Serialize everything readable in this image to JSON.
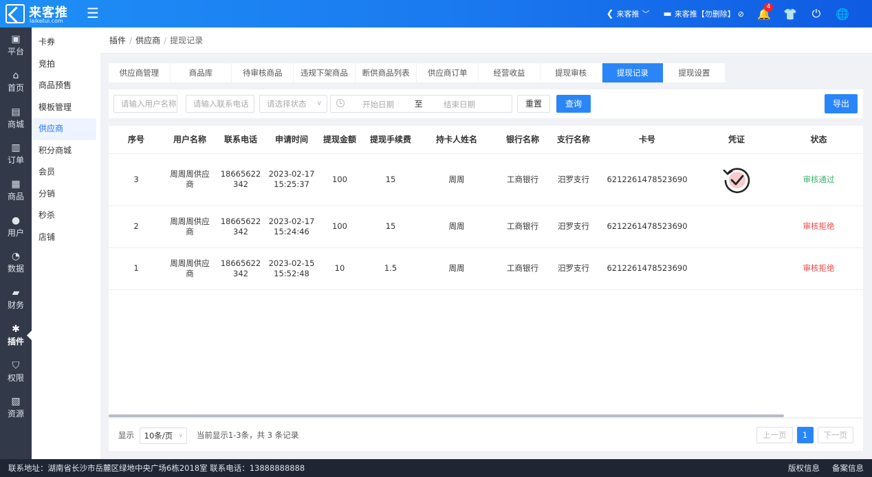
{
  "header": {
    "logo_title": "来客推",
    "logo_sub": "laiketui.com",
    "store_name": "来客推",
    "account_name": "来客推【勿删除】",
    "notification_count": "4"
  },
  "rail": [
    {
      "label": "平台",
      "icon": "monitor-icon"
    },
    {
      "label": "首页",
      "icon": "home-icon"
    },
    {
      "label": "商城",
      "icon": "store-icon"
    },
    {
      "label": "订单",
      "icon": "order-icon"
    },
    {
      "label": "商品",
      "icon": "goods-icon"
    },
    {
      "label": "用户",
      "icon": "user-icon"
    },
    {
      "label": "数据",
      "icon": "pie-chart-icon"
    },
    {
      "label": "财务",
      "icon": "wallet-icon"
    },
    {
      "label": "插件",
      "icon": "puzzle-icon"
    },
    {
      "label": "权限",
      "icon": "shield-icon"
    },
    {
      "label": "资源",
      "icon": "image-icon"
    }
  ],
  "subnav": [
    "卡券",
    "竞拍",
    "商品预售",
    "模板管理",
    "供应商",
    "积分商城",
    "会员",
    "分销",
    "秒杀",
    "店铺"
  ],
  "breadcrumb": {
    "a": "插件",
    "b": "供应商",
    "c": "提现记录"
  },
  "tabs": [
    "供应商管理",
    "商品库",
    "待审核商品",
    "违规下架商品",
    "断供商品列表",
    "供应商订单",
    "经营收益",
    "提现审核",
    "提现记录",
    "提现设置"
  ],
  "filters": {
    "user_placeholder": "请输入用户名称",
    "phone_placeholder": "请输入联系电话",
    "status_placeholder": "请选择状态",
    "start_placeholder": "开始日期",
    "to": "至",
    "end_placeholder": "结束日期",
    "reset": "重置",
    "query": "查询",
    "export": "导出"
  },
  "table": {
    "columns": [
      "序号",
      "用户名称",
      "联系电话",
      "申请时间",
      "提现金额",
      "提现手续费",
      "持卡人姓名",
      "银行名称",
      "支行名称",
      "卡号",
      "凭证",
      "状态"
    ],
    "rows": [
      {
        "no": "3",
        "user": "周周周供应商",
        "phone": "18665622342",
        "date": "2023-02-17",
        "time": "15:25:37",
        "amount": "100",
        "fee": "15",
        "holder": "周周",
        "bank": "工商银行",
        "branch": "汨罗支行",
        "card": "6212261478523690",
        "voucher": "refresh-check-icon",
        "status": "审核通过",
        "status_type": "ok"
      },
      {
        "no": "2",
        "user": "周周周供应商",
        "phone": "18665622342",
        "date": "2023-02-17",
        "time": "15:24:46",
        "amount": "100",
        "fee": "15",
        "holder": "周周",
        "bank": "工商银行",
        "branch": "汨罗支行",
        "card": "6212261478523690",
        "voucher": "",
        "status": "审核拒绝",
        "status_type": "no"
      },
      {
        "no": "1",
        "user": "周周周供应商",
        "phone": "18665622342",
        "date": "2023-02-15",
        "time": "15:52:48",
        "amount": "10",
        "fee": "1.5",
        "holder": "周周",
        "bank": "工商银行",
        "branch": "汨罗支行",
        "card": "6212261478523690",
        "voucher": "",
        "status": "审核拒绝",
        "status_type": "no"
      }
    ]
  },
  "pagination": {
    "show": "显示",
    "page_size": "10条/页",
    "summary": "当前显示1-3条，共 3 条记录",
    "prev": "上一页",
    "current": "1",
    "next": "下一页"
  },
  "footer": {
    "address": "联系地址：湖南省长沙市岳麓区绿地中央广场6栋2018室 联系电话：13888888888",
    "copyright": "版权信息",
    "record": "备案信息"
  },
  "colors": {
    "primary": "#2a86f7",
    "rail": "#323a49",
    "ok": "#3cb371",
    "reject": "#f04848"
  }
}
